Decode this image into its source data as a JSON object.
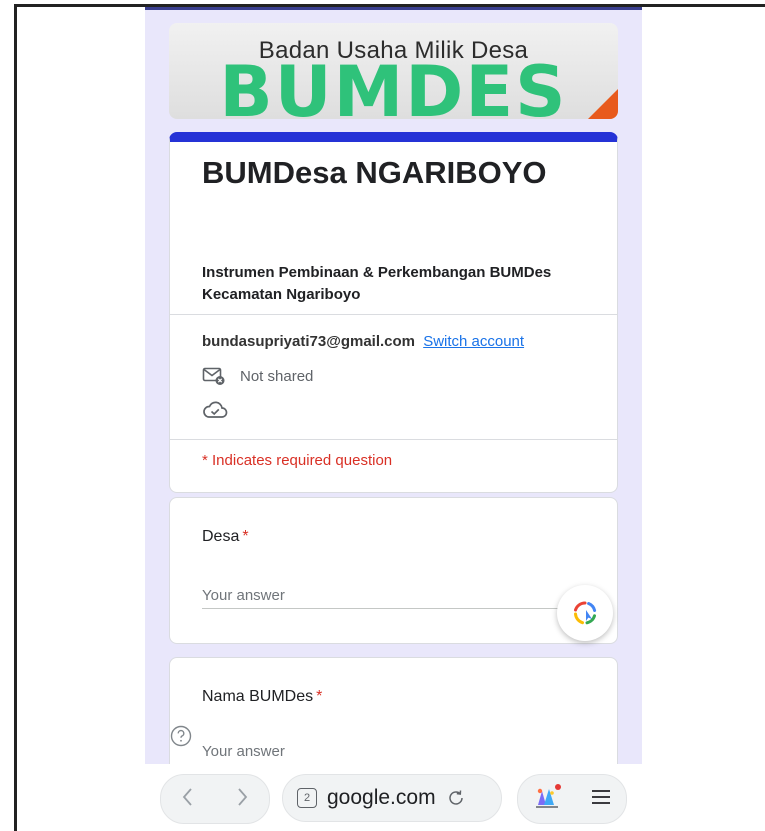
{
  "banner": {
    "subtitle": "Badan Usaha Milik Desa",
    "title": "BUMDES"
  },
  "form": {
    "title": "BUMDesa NGARIBOYO",
    "description": "Instrumen Pembinaan & Perkembangan BUMDes Kecamatan Ngariboyo",
    "account_email": "bundasupriyati73@gmail.com",
    "switch_account": "Switch account",
    "not_shared": "Not shared",
    "required_note": "* Indicates required question"
  },
  "questions": [
    {
      "label": "Desa",
      "required_mark": "*",
      "placeholder": "Your answer"
    },
    {
      "label": "Nama BUMDes",
      "required_mark": "*",
      "placeholder": "Your answer"
    }
  ],
  "browser": {
    "tab_count": "2",
    "url": "google.com"
  },
  "colors": {
    "accent": "#2532d6",
    "banner_green": "#2fc27a",
    "banner_orange": "#e85a1c",
    "required_red": "#d93025",
    "link_blue": "#1a73e8",
    "page_background": "#e9e7fb"
  },
  "icons": {
    "not_shared": "mail-x-icon",
    "cloud": "cloud-check-icon",
    "fab": "google-lens-icon",
    "help": "help-circle-icon",
    "back": "chevron-left-icon",
    "forward": "chevron-right-icon",
    "reload": "reload-icon",
    "extensions": "extension-icon",
    "menu": "hamburger-menu-icon"
  }
}
